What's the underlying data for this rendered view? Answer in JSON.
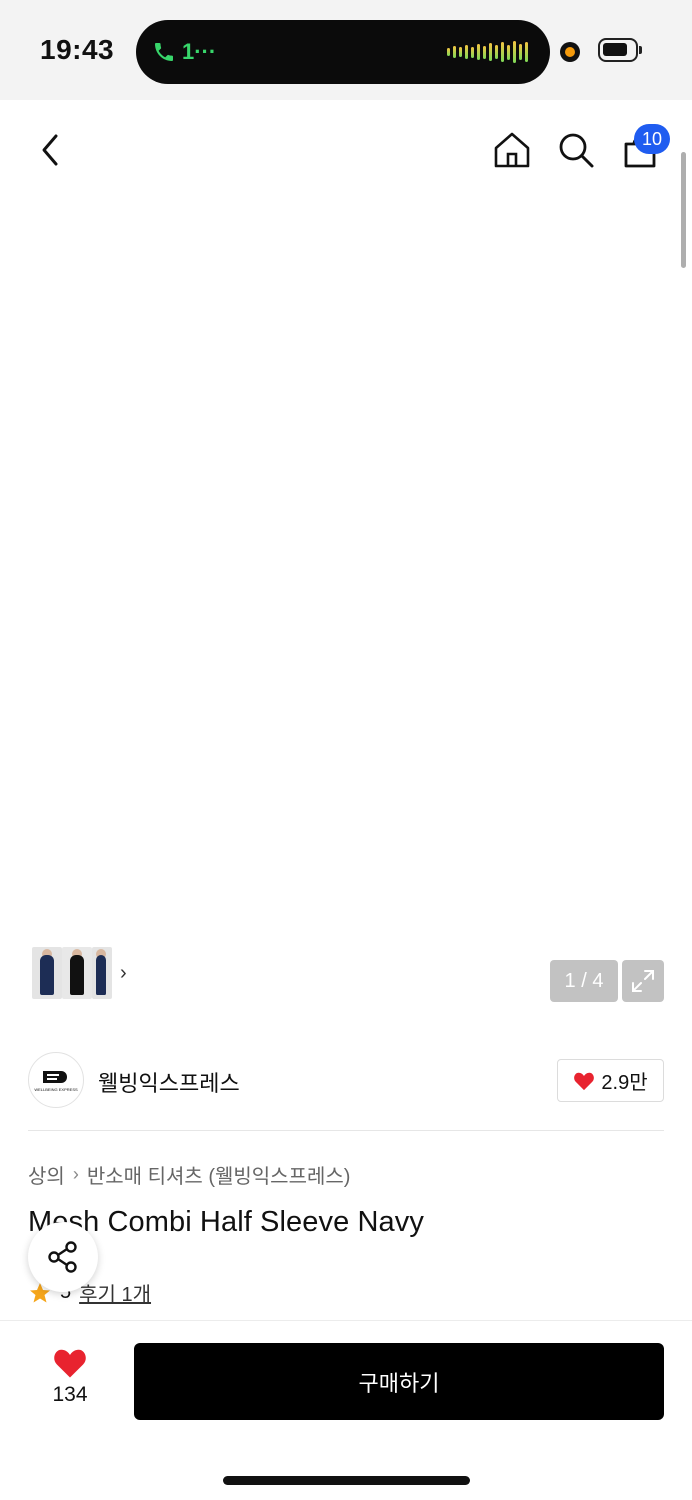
{
  "status_bar": {
    "time": "19:43",
    "call_label": "1···"
  },
  "header": {
    "cart_badge": "10"
  },
  "gallery": {
    "counter": "1 / 4",
    "thumb_arrow": "›"
  },
  "brand": {
    "name": "웰빙익스프레스",
    "logo_caption": "WELLBEING EXPRESS",
    "likes": "2.9만"
  },
  "breadcrumb": {
    "items": [
      "상의",
      "반소매 티셔츠 (웰빙익스프레스)"
    ],
    "separator": "›"
  },
  "product": {
    "title": "Mesh Combi Half Sleeve Navy",
    "rating": "5",
    "review_link": "후기 1개"
  },
  "bottom_bar": {
    "wish_count": "134",
    "buy_label": "구매하기"
  },
  "colors": {
    "accent_badge": "#1f5cf0",
    "heart": "#e8232f",
    "buy_button": "#000000",
    "star": "#f5a51a",
    "call_green": "#38d66b"
  },
  "icons": [
    "back-icon",
    "home-icon",
    "search-icon",
    "cart-icon",
    "expand-icon",
    "heart-icon",
    "share-icon",
    "star-icon",
    "phone-icon"
  ]
}
